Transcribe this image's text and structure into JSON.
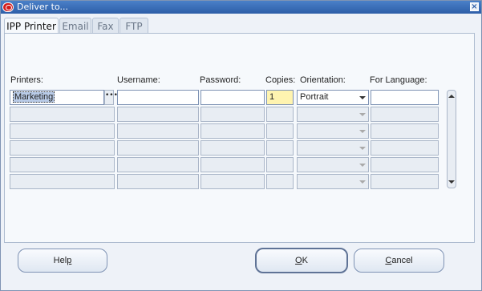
{
  "window": {
    "title": "Deliver to..."
  },
  "tabs": [
    {
      "label": "IPP Printer",
      "active": true
    },
    {
      "label": "Email",
      "active": false
    },
    {
      "label": "Fax",
      "active": false
    },
    {
      "label": "FTP",
      "active": false
    }
  ],
  "columns": {
    "printers": "Printers:",
    "username": "Username:",
    "password": "Password:",
    "copies": "Copies:",
    "orientation": "Orientation:",
    "language": "For Language:"
  },
  "rows": [
    {
      "printer": "Marketing",
      "username": "",
      "password": "",
      "copies": "1",
      "orientation": "Portrait",
      "language": ""
    },
    {
      "printer": "",
      "username": "",
      "password": "",
      "copies": "",
      "orientation": "",
      "language": ""
    },
    {
      "printer": "",
      "username": "",
      "password": "",
      "copies": "",
      "orientation": "",
      "language": ""
    },
    {
      "printer": "",
      "username": "",
      "password": "",
      "copies": "",
      "orientation": "",
      "language": ""
    },
    {
      "printer": "",
      "username": "",
      "password": "",
      "copies": "",
      "orientation": "",
      "language": ""
    },
    {
      "printer": "",
      "username": "",
      "password": "",
      "copies": "",
      "orientation": "",
      "language": ""
    }
  ],
  "buttons": {
    "help": {
      "pre": "Hel",
      "u": "p",
      "post": ""
    },
    "ok": {
      "pre": "",
      "u": "O",
      "post": "K"
    },
    "cancel": {
      "pre": "",
      "u": "C",
      "post": "ancel"
    }
  },
  "colors": {
    "titlebar": "#2d5ea8",
    "active_field": "#fff4b0",
    "close_icon": "#2d5ea8"
  }
}
